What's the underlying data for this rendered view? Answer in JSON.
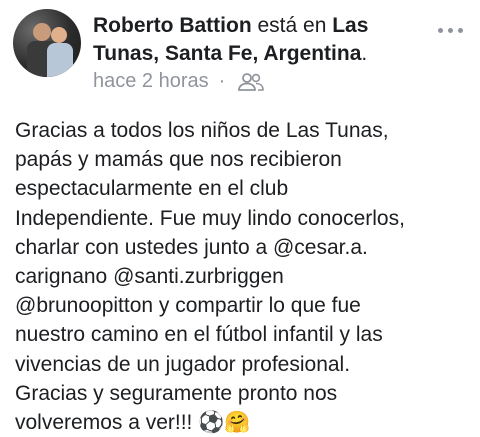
{
  "post": {
    "author_name": "Roberto Battion",
    "verb": " está en ",
    "location": "Las Tunas, Santa Fe, Argentina",
    "location_suffix": ".",
    "time": "hace 2 horas",
    "separator": "·",
    "privacy_icon": "friends-icon",
    "more_icon": "more-dots-icon",
    "body_text": "Gracias a todos los niños de Las Tunas,\npapás y mamás que nos recibieron\nespectacularmente en el club\nIndependiente. Fue muy lindo conocerlos,\ncharlar con ustedes junto a @cesar.a.\ncarignano @santi.zurbriggen\n@brunoopitton y compartir lo que fue\nnuestro camino en el fútbol infantil y las\nvivencias de un  jugador profesional.\nGracias y seguramente pronto nos\nvolveremos a ver!!! ⚽🤗"
  }
}
